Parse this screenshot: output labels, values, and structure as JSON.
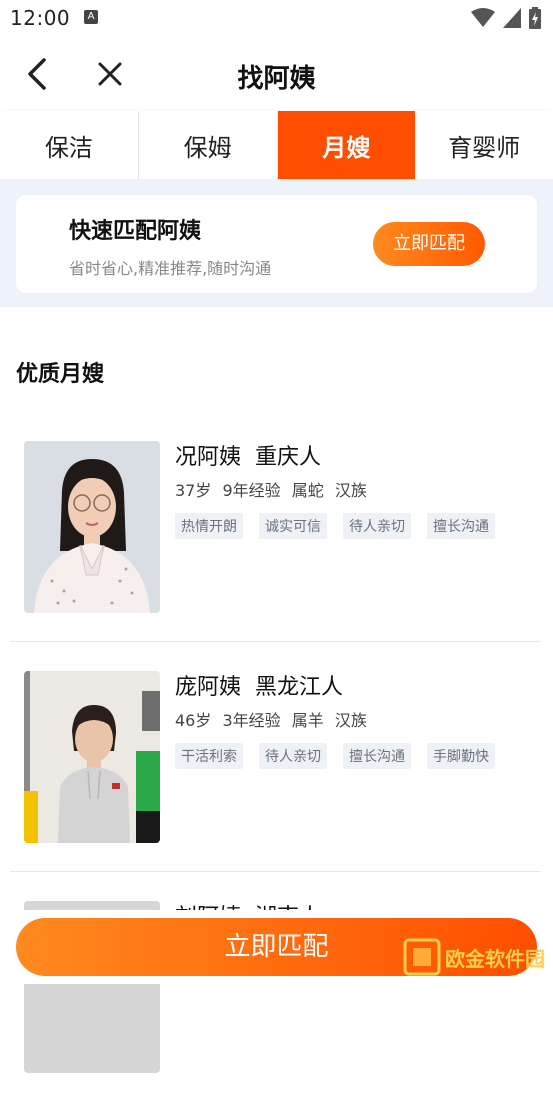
{
  "status_bar": {
    "time": "12:00",
    "a_label": "A"
  },
  "nav": {
    "title": "找阿姨"
  },
  "tabs": [
    {
      "label": "保洁"
    },
    {
      "label": "保姆"
    },
    {
      "label": "月嫂"
    },
    {
      "label": "育婴师"
    }
  ],
  "quick_match": {
    "title": "快速匹配阿姨",
    "subtitle": "省时省心,精准推荐,随时沟通",
    "button_label": "立即匹配"
  },
  "section": {
    "title": "优质月嫂"
  },
  "nannies": [
    {
      "name": "况阿姨",
      "origin": "重庆人",
      "age": "37岁",
      "experience": "9年经验",
      "zodiac": "属蛇",
      "ethnicity": "汉族",
      "tags": [
        "热情开朗",
        "诚实可信",
        "待人亲切",
        "擅长沟通"
      ]
    },
    {
      "name": "庞阿姨",
      "origin": "黑龙江人",
      "age": "46岁",
      "experience": "3年经验",
      "zodiac": "属羊",
      "ethnicity": "汉族",
      "tags": [
        "干活利索",
        "待人亲切",
        "擅长沟通",
        "手脚勤快"
      ]
    },
    {
      "name": "刘阿姨",
      "origin": "湖南人"
    }
  ],
  "bottom": {
    "button_label": "立即匹配",
    "watermark": "欧金软件园"
  },
  "colors": {
    "accent": "#ff4e00",
    "accent_light": "#ff8a1f",
    "band_bg": "#eef3fb",
    "tag_bg": "#eef1f5"
  }
}
